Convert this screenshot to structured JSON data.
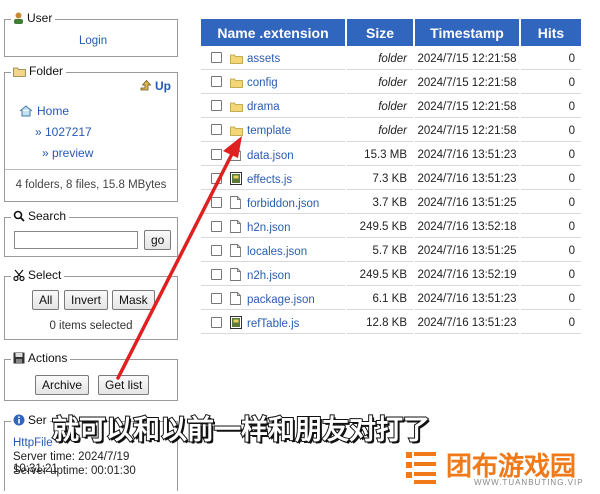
{
  "sidebar": {
    "user": {
      "title": "User",
      "login_link": "Login"
    },
    "folder": {
      "title": "Folder",
      "up_label": "Up",
      "tree": [
        "Home",
        "» 1027217",
        "» preview"
      ],
      "summary": "4 folders, 8 files, 15.8 MBytes"
    },
    "search": {
      "title": "Search",
      "input_value": "",
      "go_label": "go"
    },
    "select": {
      "title": "Select",
      "all_label": "All",
      "invert_label": "Invert",
      "mask_label": "Mask",
      "status": "0 items selected"
    },
    "actions": {
      "title": "Actions",
      "archive_label": "Archive",
      "getlist_label": "Get list"
    },
    "server": {
      "title": "Ser",
      "link_partial": "HttpFile",
      "time": "Server time: 2024/7/19 10:31:21",
      "uptime": "Server uptime: 00:01:30"
    }
  },
  "table": {
    "headers": [
      "Name .extension",
      "Size",
      "Timestamp",
      "Hits"
    ],
    "rows": [
      {
        "name": "assets",
        "size": "folder",
        "ts": "2024/7/15 12:21:58",
        "hits": "0",
        "type": "folder"
      },
      {
        "name": "config",
        "size": "folder",
        "ts": "2024/7/15 12:21:58",
        "hits": "0",
        "type": "folder"
      },
      {
        "name": "drama",
        "size": "folder",
        "ts": "2024/7/15 12:21:58",
        "hits": "0",
        "type": "folder"
      },
      {
        "name": "template",
        "size": "folder",
        "ts": "2024/7/15 12:21:58",
        "hits": "0",
        "type": "folder"
      },
      {
        "name": "data.json",
        "size": "15.3 MB",
        "ts": "2024/7/16 13:51:23",
        "hits": "0",
        "type": "file"
      },
      {
        "name": "effects.js",
        "size": "7.3 KB",
        "ts": "2024/7/16 13:51:23",
        "hits": "0",
        "type": "script"
      },
      {
        "name": "forbiddon.json",
        "size": "3.7 KB",
        "ts": "2024/7/16 13:51:25",
        "hits": "0",
        "type": "file"
      },
      {
        "name": "h2n.json",
        "size": "249.5 KB",
        "ts": "2024/7/16 13:52:18",
        "hits": "0",
        "type": "file"
      },
      {
        "name": "locales.json",
        "size": "5.7 KB",
        "ts": "2024/7/16 13:51:25",
        "hits": "0",
        "type": "file"
      },
      {
        "name": "n2h.json",
        "size": "249.5 KB",
        "ts": "2024/7/16 13:52:19",
        "hits": "0",
        "type": "file"
      },
      {
        "name": "package.json",
        "size": "6.1 KB",
        "ts": "2024/7/16 13:51:23",
        "hits": "0",
        "type": "file"
      },
      {
        "name": "refTable.js",
        "size": "12.8 KB",
        "ts": "2024/7/16 13:51:23",
        "hits": "0",
        "type": "script"
      }
    ]
  },
  "overlay": {
    "subtitle": "就可以和以前一样和朋友对打了",
    "watermark_text": "团布游戏园",
    "watermark_url": "WWW.TUANBUTING.VIP",
    "arrow_color": "#e02020",
    "accent": "#3066be"
  }
}
